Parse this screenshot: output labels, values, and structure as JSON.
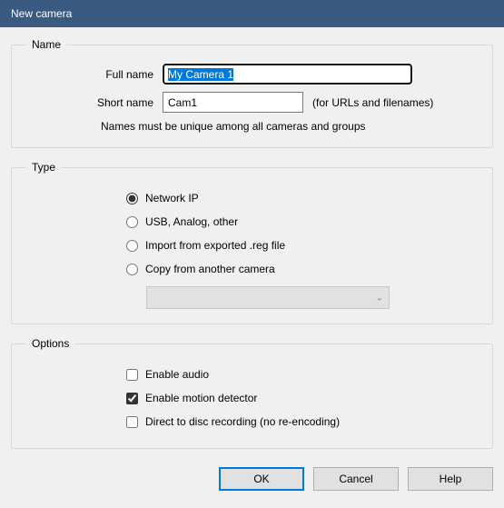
{
  "window": {
    "title": "New camera"
  },
  "name_section": {
    "legend": "Name",
    "full_label": "Full name",
    "full_value": "My Camera 1",
    "short_label": "Short name",
    "short_value": "Cam1",
    "short_hint": "(for URLs and filenames)",
    "note": "Names must be unique among all cameras and groups"
  },
  "type_section": {
    "legend": "Type",
    "options": [
      "Network IP",
      "USB, Analog, other",
      "Import from exported .reg file",
      "Copy from another camera"
    ],
    "selected_index": 0
  },
  "options_section": {
    "legend": "Options",
    "items": [
      {
        "label": "Enable audio",
        "checked": false
      },
      {
        "label": "Enable motion detector",
        "checked": true
      },
      {
        "label": "Direct to disc recording (no re-encoding)",
        "checked": false
      }
    ]
  },
  "buttons": {
    "ok": "OK",
    "cancel": "Cancel",
    "help": "Help"
  }
}
